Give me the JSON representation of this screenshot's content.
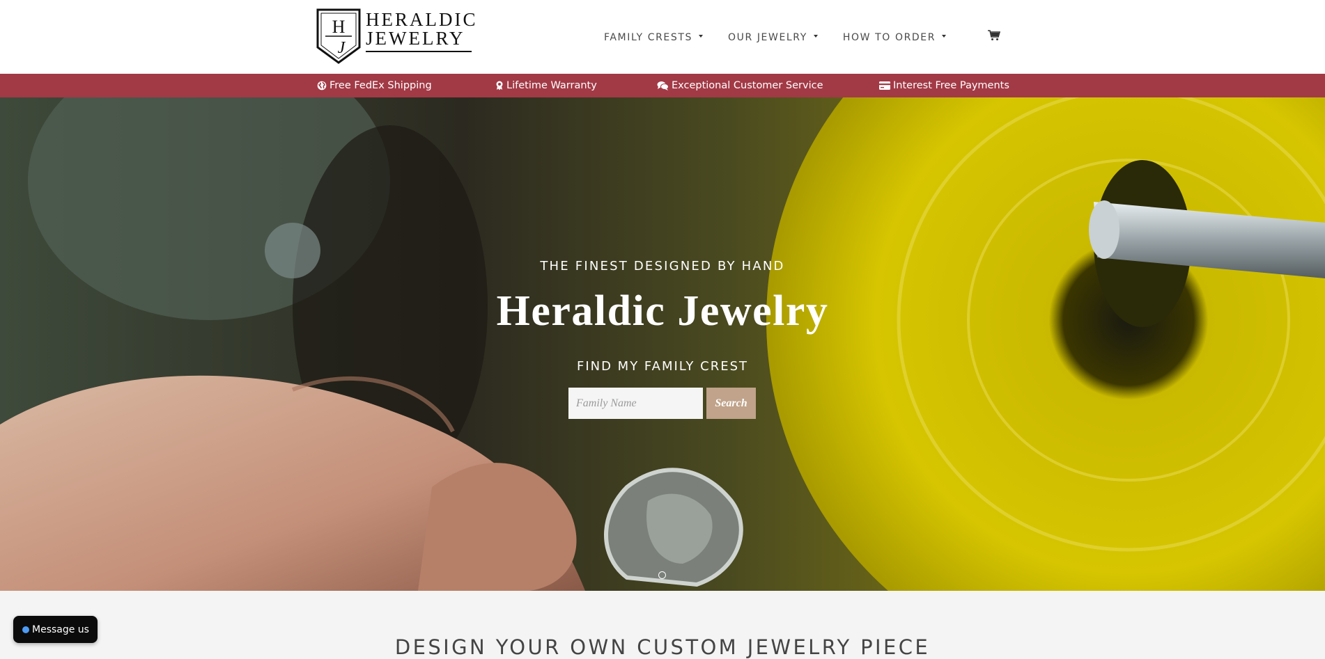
{
  "brand": {
    "line1": "HERALDIC",
    "line2": "JEWELRY",
    "monogram_top": "H",
    "monogram_bottom": "J"
  },
  "nav": {
    "items": [
      {
        "label": "FAMILY CRESTS"
      },
      {
        "label": "OUR JEWELRY"
      },
      {
        "label": "HOW TO ORDER"
      }
    ],
    "cart_icon": "cart-icon"
  },
  "promo": {
    "color": "#a23a46",
    "items": [
      {
        "label": "Free FedEx Shipping",
        "icon": "globe-icon"
      },
      {
        "label": "Lifetime Warranty",
        "icon": "award-icon"
      },
      {
        "label": "Exceptional Customer Service",
        "icon": "chat-icon"
      },
      {
        "label": "Interest Free Payments",
        "icon": "credit-card-icon"
      }
    ]
  },
  "hero": {
    "tagline": "THE FINEST DESIGNED BY HAND",
    "title": "Heraldic Jewelry",
    "find": "FIND MY FAMILY CREST",
    "search_placeholder": "Family Name",
    "search_button": "Search",
    "button_color": "#c0a38a"
  },
  "section": {
    "title": "DESIGN YOUR OWN CUSTOM JEWELRY PIECE"
  },
  "chat": {
    "label": "Message us"
  }
}
